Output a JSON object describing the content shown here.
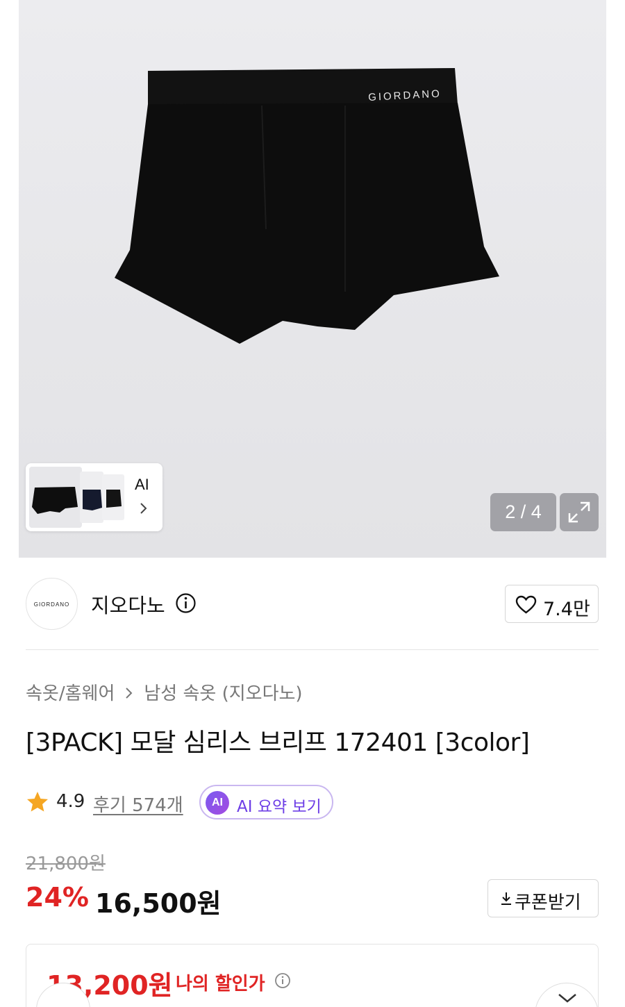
{
  "gallery": {
    "counter": "2 / 4",
    "thumb_ai_label": "AI",
    "product_logo_text": "GIORDANO"
  },
  "brand": {
    "logo_text": "GIORDANO",
    "name": "지오다노",
    "likes": "7.4만"
  },
  "breadcrumb": {
    "level1": "속옷/홈웨어",
    "level2": "남성 속옷 (지오다노)"
  },
  "product": {
    "title": "[3PACK] 모달 심리스 브리프 172401 [3color]",
    "rating": "4.9",
    "reviews": "후기 574개",
    "ai_badge": "AI",
    "ai_summary": "AI 요약 보기"
  },
  "price": {
    "original": "21,800원",
    "discount": "24%",
    "current": "16,500원",
    "coupon_label": "쿠폰받기",
    "my_price": "13,200원",
    "my_price_label": "나의 할인가"
  },
  "colors": {
    "discount_red": "#e02424",
    "ai_purple": "#6d3ee6",
    "star_orange": "#f5a623"
  }
}
